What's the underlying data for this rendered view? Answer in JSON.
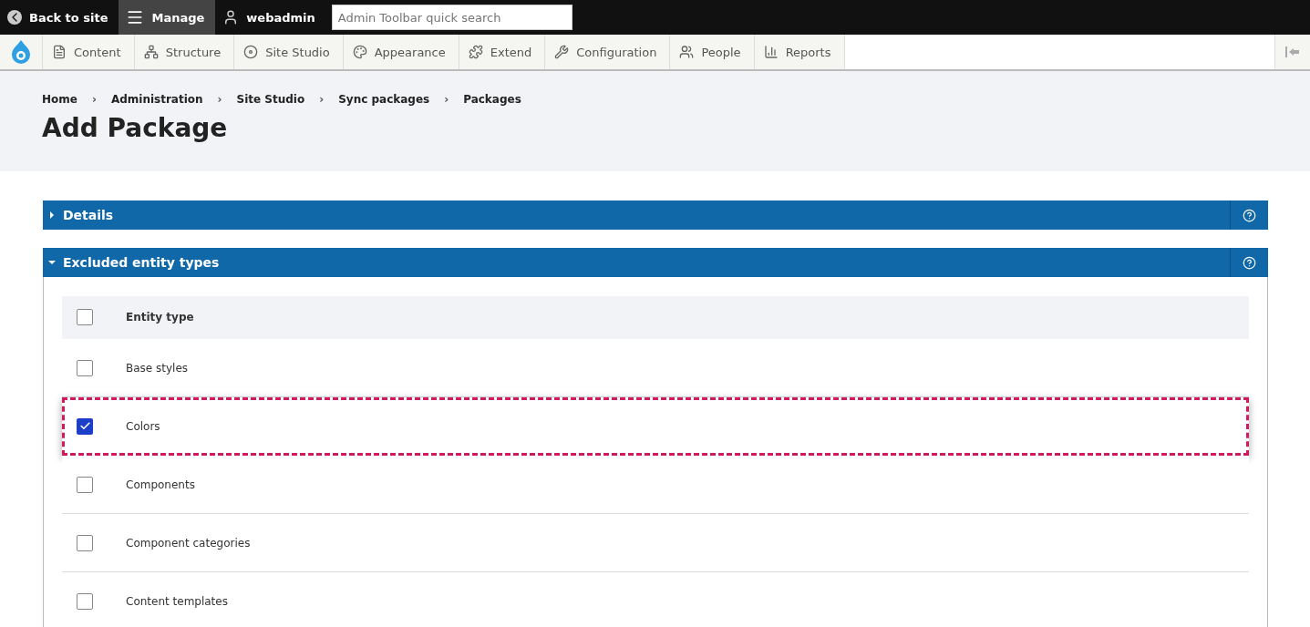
{
  "toolbar": {
    "back": "Back to site",
    "manage": "Manage",
    "user": "webadmin",
    "search": {
      "placeholder": "Admin Toolbar quick search"
    }
  },
  "menu": [
    {
      "label": "Content",
      "kind": "content"
    },
    {
      "label": "Structure",
      "kind": "structure"
    },
    {
      "label": "Site Studio",
      "kind": "studio"
    },
    {
      "label": "Appearance",
      "kind": "appearance"
    },
    {
      "label": "Extend",
      "kind": "extend"
    },
    {
      "label": "Configuration",
      "kind": "config"
    },
    {
      "label": "People",
      "kind": "people"
    },
    {
      "label": "Reports",
      "kind": "reports"
    }
  ],
  "breadcrumb": [
    "Home",
    "Administration",
    "Site Studio",
    "Sync packages",
    "Packages"
  ],
  "breadcrumb_separators": [
    "›",
    "›",
    "›",
    "›"
  ],
  "title": "Add Package",
  "sections": [
    {
      "label": "Details",
      "expanded": false
    },
    {
      "label": "Excluded entity types",
      "expanded": true
    }
  ],
  "table": {
    "header": {
      "label": "Entity type",
      "checked": false
    },
    "rows": [
      {
        "label": "Base styles",
        "checked": false,
        "highlighted": false
      },
      {
        "label": "Colors",
        "checked": true,
        "highlighted": true
      },
      {
        "label": "Components",
        "checked": false,
        "highlighted": false
      },
      {
        "label": "Component categories",
        "checked": false,
        "highlighted": false
      },
      {
        "label": "Content templates",
        "checked": false,
        "highlighted": false
      }
    ]
  }
}
